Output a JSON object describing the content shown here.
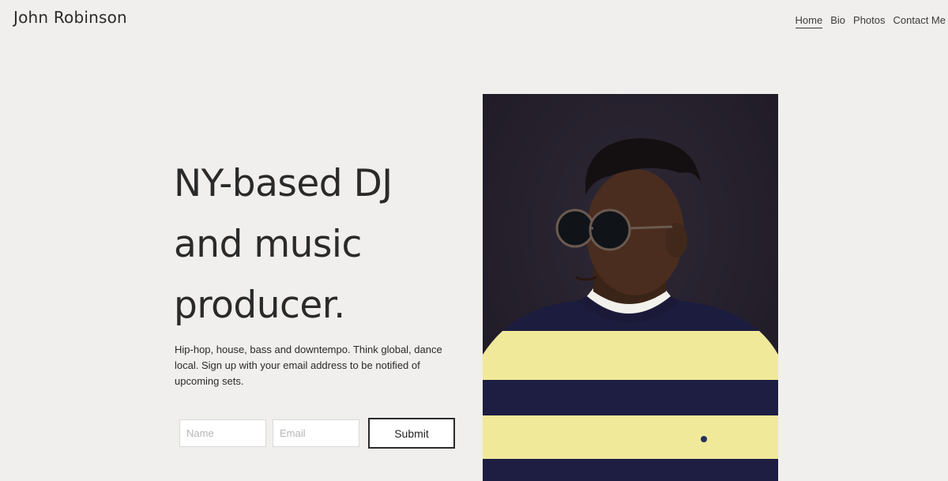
{
  "header": {
    "site_title": "John Robinson"
  },
  "nav": {
    "items": [
      {
        "label": "Home",
        "active": true
      },
      {
        "label": "Bio",
        "active": false
      },
      {
        "label": "Photos",
        "active": false
      },
      {
        "label": "Contact Me",
        "active": false
      }
    ]
  },
  "hero": {
    "headline_lines": [
      "NY-based DJ",
      "and music",
      "producer."
    ],
    "description_lines": [
      "Hip-hop, house, bass and downtempo. Think global, dance",
      "local. Sign up with your email address to be notified of",
      "upcoming sets."
    ]
  },
  "signup": {
    "name_placeholder": "Name",
    "name_value": "",
    "email_placeholder": "Email",
    "email_value": "",
    "submit_label": "Submit"
  },
  "colors": {
    "background": "#f0efed",
    "text": "#2a2a2a",
    "photo_backdrop": "#26212c",
    "sweater_yellow": "#f0e99a",
    "sweater_navy": "#1c1c3e"
  }
}
